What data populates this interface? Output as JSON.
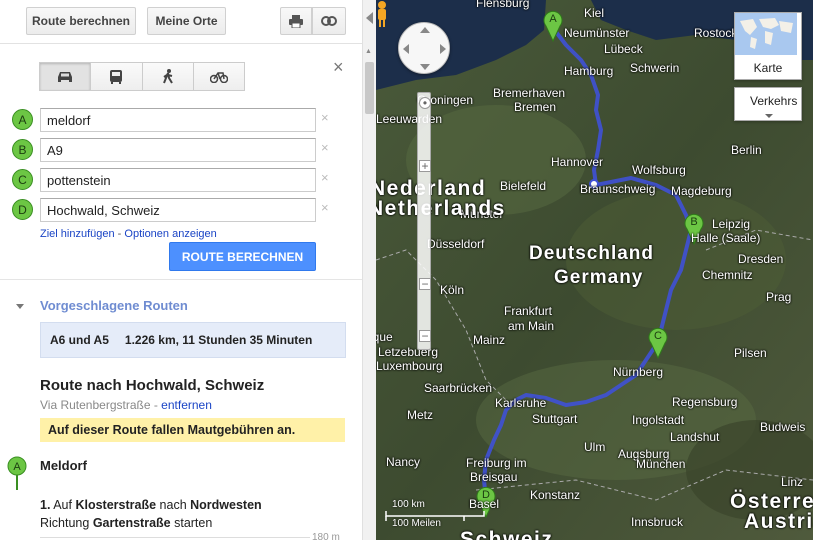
{
  "toolbar": {
    "route_button": "Route berechnen",
    "places_button": "Meine Orte",
    "print_icon": "printer-icon",
    "link_icon": "link-icon"
  },
  "modes": [
    "car-icon",
    "bus-icon",
    "walk-icon",
    "bicycle-icon"
  ],
  "waypoints": [
    {
      "letter": "A",
      "value": "meldorf"
    },
    {
      "letter": "B",
      "value": "A9"
    },
    {
      "letter": "C",
      "value": "pottenstein"
    },
    {
      "letter": "D",
      "value": "Hochwald, Schweiz"
    }
  ],
  "links": {
    "add_destination": "Ziel hinzufügen",
    "separator": " - ",
    "show_options": "Optionen anzeigen"
  },
  "calculate_button": "ROUTE BERECHNEN",
  "suggestions": {
    "heading": "Vorgeschlagene Routen",
    "route_name": "A6 und A5",
    "route_summary": "1.226 km, 11 Stunden 35 Minuten"
  },
  "route": {
    "title": "Route nach Hochwald, Schweiz",
    "via_prefix": "Via Rutenbergstraße - ",
    "remove_link": "entfernen",
    "toll_notice": "Auf dieser Route fallen Mautgebühren an.",
    "origin_marker": "A",
    "origin": "Meldorf",
    "step1": {
      "number": "1.",
      "t1": " Auf ",
      "street1": "Klosterstraße",
      "t2": " nach ",
      "direction": "Nordwesten",
      "t3": "Richtung ",
      "street2": "Gartenstraße",
      "t4": " starten",
      "distance": "180 m"
    }
  },
  "map": {
    "layer_button": "Karte",
    "traffic_button": "Verkehrs",
    "scale_km": "100 km",
    "scale_miles": "100 Meilen",
    "markers": [
      "A",
      "B",
      "C",
      "D"
    ],
    "labels": [
      {
        "text": "Kiel",
        "cls": ""
      },
      {
        "text": "Flensburg",
        "cls": ""
      },
      {
        "text": "Neumünster",
        "cls": ""
      },
      {
        "text": "Lübeck",
        "cls": ""
      },
      {
        "text": "Rostock",
        "cls": ""
      },
      {
        "text": "Hamburg",
        "cls": ""
      },
      {
        "text": "Schwerin",
        "cls": ""
      },
      {
        "text": "Bremerhaven",
        "cls": ""
      },
      {
        "text": "Bremen",
        "cls": ""
      },
      {
        "text": "Groningen",
        "cls": ""
      },
      {
        "text": "Leeuwarden",
        "cls": ""
      },
      {
        "text": "Hannover",
        "cls": ""
      },
      {
        "text": "Wolfsburg",
        "cls": ""
      },
      {
        "text": "Braunschweig",
        "cls": ""
      },
      {
        "text": "Magdeburg",
        "cls": ""
      },
      {
        "text": "Berlin",
        "cls": ""
      },
      {
        "text": "Bielefeld",
        "cls": ""
      },
      {
        "text": "Münster",
        "cls": ""
      },
      {
        "text": "Halle (Saale)",
        "cls": ""
      },
      {
        "text": "Leipzig",
        "cls": ""
      },
      {
        "text": "Dresden",
        "cls": ""
      },
      {
        "text": "Chemnitz",
        "cls": ""
      },
      {
        "text": "Düsseldorf",
        "cls": ""
      },
      {
        "text": "Köln",
        "cls": ""
      },
      {
        "text": "Frankfurt",
        "cls": ""
      },
      {
        "text": "am Main",
        "cls": ""
      },
      {
        "text": "Mainz",
        "cls": ""
      },
      {
        "text": "Nürnberg",
        "cls": ""
      },
      {
        "text": "Pilsen",
        "cls": ""
      },
      {
        "text": "Saarbrücken",
        "cls": ""
      },
      {
        "text": "Karlsruhe",
        "cls": ""
      },
      {
        "text": "Stuttgart",
        "cls": ""
      },
      {
        "text": "Metz",
        "cls": ""
      },
      {
        "text": "Nancy",
        "cls": ""
      },
      {
        "text": "Ulm",
        "cls": ""
      },
      {
        "text": "Ingolstadt",
        "cls": ""
      },
      {
        "text": "Landshut",
        "cls": ""
      },
      {
        "text": "Regensburg",
        "cls": ""
      },
      {
        "text": "Augsburg",
        "cls": ""
      },
      {
        "text": "München",
        "cls": ""
      },
      {
        "text": "Freiburg im",
        "cls": ""
      },
      {
        "text": "Breisgau",
        "cls": ""
      },
      {
        "text": "Konstanz",
        "cls": ""
      },
      {
        "text": "Basel",
        "cls": ""
      },
      {
        "text": "Innsbruck",
        "cls": ""
      },
      {
        "text": "Budweis",
        "cls": ""
      },
      {
        "text": "Linz",
        "cls": ""
      },
      {
        "text": "Letzebuerg",
        "cls": ""
      },
      {
        "text": "Luxembourg",
        "cls": ""
      },
      {
        "text": "Prag",
        "cls": ""
      },
      {
        "text": "Deutschland",
        "cls": "big"
      },
      {
        "text": "Germany",
        "cls": "big"
      },
      {
        "text": "Nederland",
        "cls": "country"
      },
      {
        "text": "Netherlands",
        "cls": "country"
      },
      {
        "text": "Schweiz",
        "cls": "country"
      },
      {
        "text": "Österreich",
        "cls": "country"
      },
      {
        "text": "Austria",
        "cls": "country"
      },
      {
        "text": "Belgique",
        "cls": ""
      }
    ]
  },
  "colors": {
    "route": "#3f51d6",
    "marker": "#6cc644",
    "calc_button": "#4d90fe",
    "link": "#1a44c5",
    "toll_bg": "#fff1a8",
    "route_box_bg": "#e5ecf9"
  }
}
